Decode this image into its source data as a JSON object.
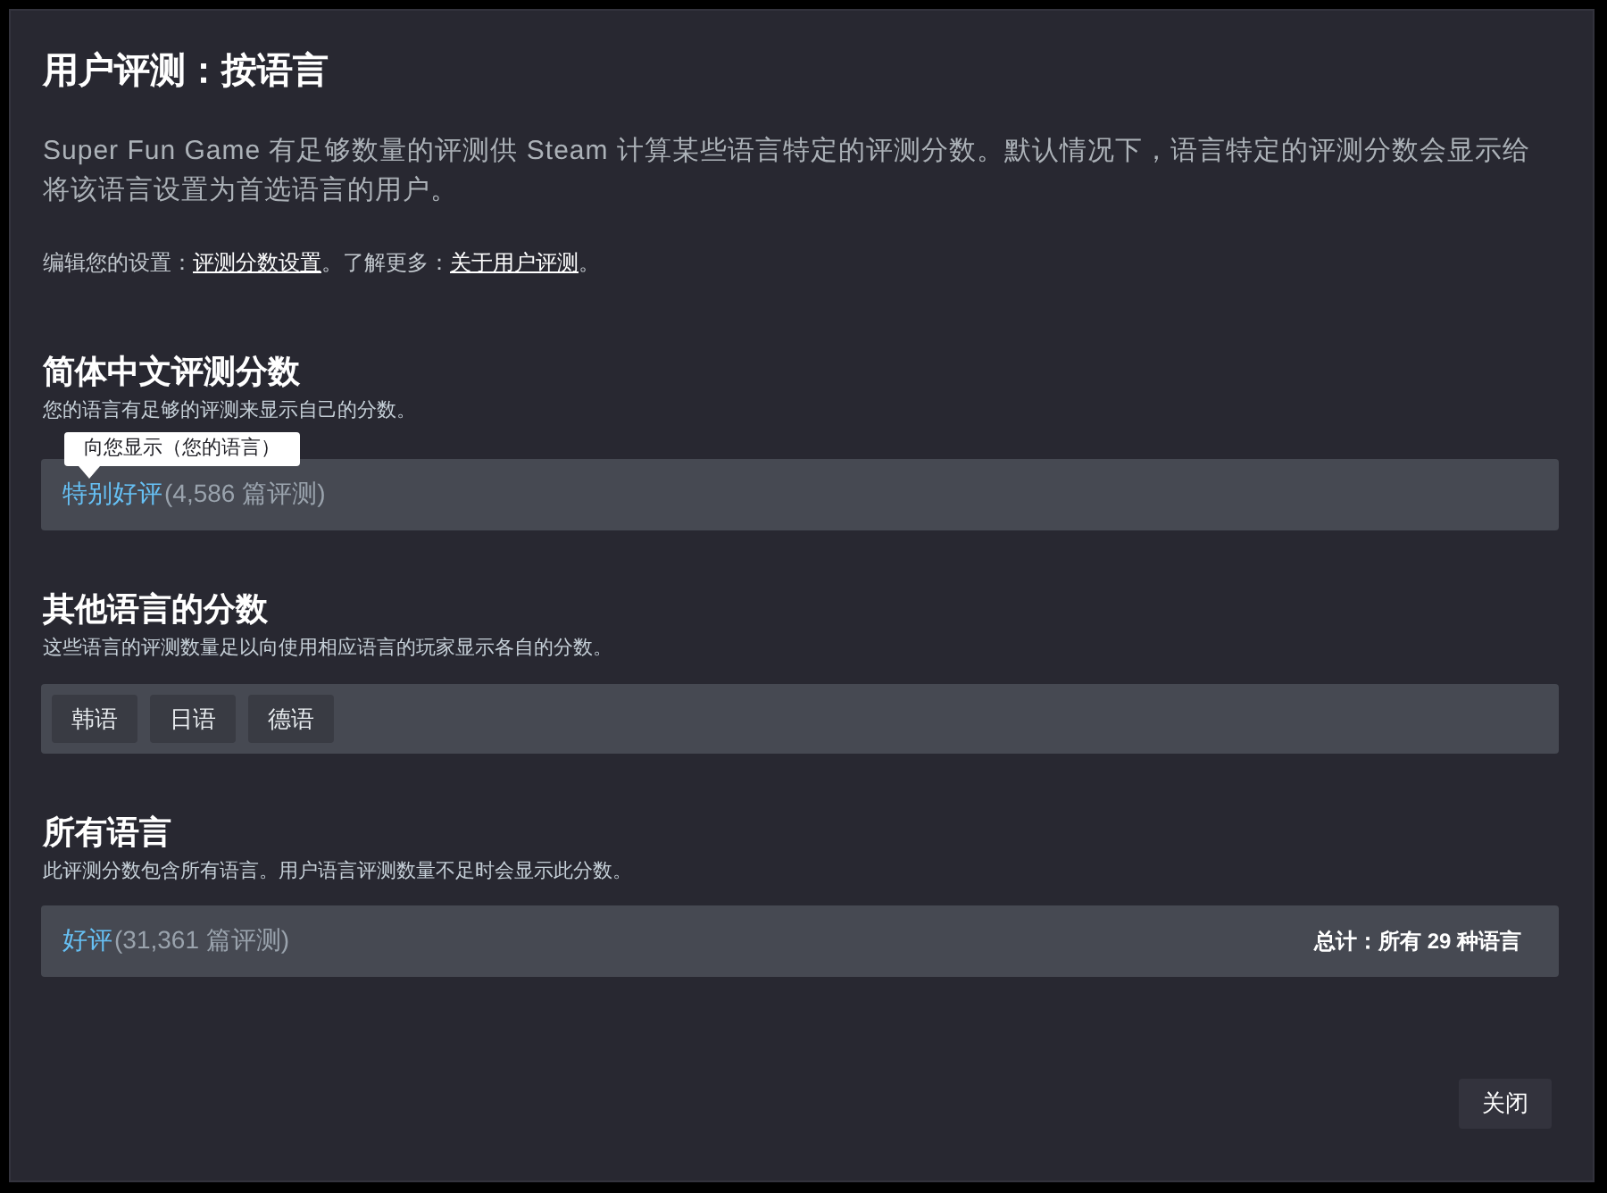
{
  "dialog": {
    "title": "用户评测：按语言"
  },
  "intro": "Super Fun Game 有足够数量的评测供 Steam 计算某些语言特定的评测分数。默认情况下，语言特定的评测分数会显示给将该语言设置为首选语言的用户。",
  "settings_line": [
    {
      "kind": "text",
      "text": "编辑您的设置："
    },
    {
      "kind": "link",
      "text": "评测分数设置"
    },
    {
      "kind": "text",
      "text": "。了解更多："
    },
    {
      "kind": "link",
      "text": "关于用户评测"
    },
    {
      "kind": "text",
      "text": "。"
    }
  ],
  "sections": [
    {
      "kind": "score",
      "heading": "简体中文评测分数",
      "subtitle": "您的语言有足够的评测来显示自己的分数。",
      "tooltip": "向您显示（您的语言）",
      "rating": "特别好评",
      "count": "(4,586 篇评测)"
    },
    {
      "kind": "languages",
      "heading": "其他语言的分数",
      "subtitle": "这些语言的评测数量足以向使用相应语言的玩家显示各自的分数。",
      "languages": [
        "韩语",
        "日语",
        "德语"
      ]
    },
    {
      "kind": "score",
      "heading": "所有语言",
      "subtitle": "此评测分数包含所有语言。用户语言评测数量不足时会显示此分数。",
      "rating": "好评",
      "count": "(31,361 篇评测)",
      "total": "总计：所有 29 种语言"
    }
  ],
  "buttons": [
    {
      "label": "关闭"
    }
  ]
}
